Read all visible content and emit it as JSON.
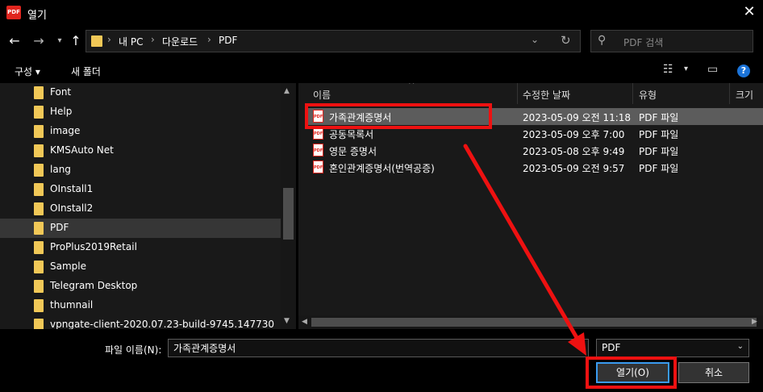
{
  "window": {
    "title": "열기",
    "app_icon_text": "PDF"
  },
  "navigation": {
    "breadcrumb": [
      "내 PC",
      "다운로드",
      "PDF"
    ],
    "search_placeholder": "PDF 검색"
  },
  "toolbar": {
    "organize_label": "구성 ▾",
    "new_folder_label": "새 폴더"
  },
  "sidebar": {
    "items": [
      {
        "label": "Font"
      },
      {
        "label": "Help"
      },
      {
        "label": "image"
      },
      {
        "label": "KMSAuto Net"
      },
      {
        "label": "lang"
      },
      {
        "label": "OInstall1"
      },
      {
        "label": "OInstall2"
      },
      {
        "label": "PDF",
        "selected": true
      },
      {
        "label": "ProPlus2019Retail"
      },
      {
        "label": "Sample"
      },
      {
        "label": "Telegram Desktop"
      },
      {
        "label": "thumnail"
      },
      {
        "label": "vpngate-client-2020.07.23-build-9745.147730"
      }
    ]
  },
  "file_list": {
    "columns": [
      "이름",
      "수정한 날짜",
      "유형",
      "크기"
    ],
    "rows": [
      {
        "name": "가족관계증명서",
        "date": "2023-05-09 오전 11:18",
        "type": "PDF 파일",
        "selected": true
      },
      {
        "name": "공동목록서",
        "date": "2023-05-09 오후 7:00",
        "type": "PDF 파일"
      },
      {
        "name": "영문 증명서",
        "date": "2023-05-08 오후 9:49",
        "type": "PDF 파일"
      },
      {
        "name": "혼인관계증명서(번역공증)",
        "date": "2023-05-09 오전 9:57",
        "type": "PDF 파일"
      }
    ]
  },
  "footer": {
    "filename_label": "파일 이름(N):",
    "filename_value": "가족관계증명서",
    "filetype_value": "PDF",
    "open_label": "열기(O)",
    "cancel_label": "취소"
  },
  "colors": {
    "annotation": "#ee1111",
    "folder": "#f1c857",
    "pdf_red": "#e0251e"
  }
}
